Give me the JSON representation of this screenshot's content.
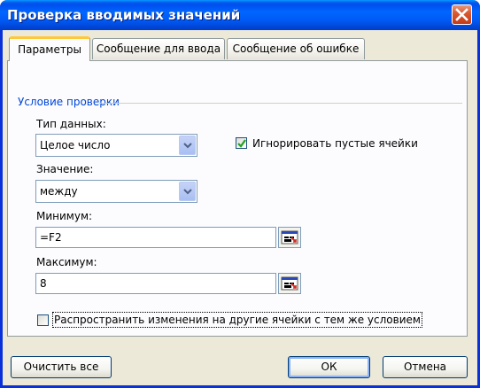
{
  "window": {
    "title": "Проверка вводимых значений"
  },
  "tabs": [
    {
      "label": "Параметры",
      "active": true
    },
    {
      "label": "Сообщение для ввода",
      "active": false
    },
    {
      "label": "Сообщение об ошибке",
      "active": false
    }
  ],
  "group": {
    "label": "Условие проверки"
  },
  "data_type": {
    "label": "Тип данных:",
    "value": "Целое число"
  },
  "ignore_blank": {
    "label": "Игнорировать пустые ячейки",
    "checked": true
  },
  "condition": {
    "label": "Значение:",
    "value": "между"
  },
  "minimum": {
    "label": "Минимум:",
    "value": "=F2"
  },
  "maximum": {
    "label": "Максимум:",
    "value": "8"
  },
  "apply_all": {
    "label": "Распространить изменения на другие ячейки с тем же условием",
    "checked": false
  },
  "buttons": {
    "clear": "Очистить все",
    "ok": "ОК",
    "cancel": "Отмена"
  },
  "colors": {
    "titlebar": "#0058f2",
    "accent_tab": "#ffc83c",
    "group_label": "#0046d5",
    "close_button": "#c43b17"
  }
}
